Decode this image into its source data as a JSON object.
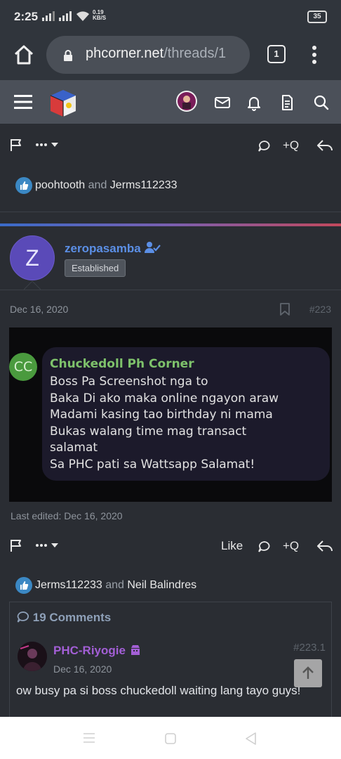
{
  "status": {
    "time": "2:25",
    "net_speed": "0.19",
    "net_unit": "KB/S",
    "battery": "35"
  },
  "browser": {
    "url_host": "phcorner.net",
    "url_rest": "/threads/1",
    "tab_count": "1"
  },
  "post_top": {
    "liked_by_1": "poohtooth",
    "liked_and": "and",
    "liked_by_2": "Jerms112233"
  },
  "post": {
    "avatar_letter": "Z",
    "username": "zeropasamba",
    "badge": "Established",
    "date": "Dec 16, 2020",
    "number": "#223",
    "screenshot": {
      "avatar_initials": "CC",
      "sender": "Chuckedoll Ph Corner",
      "message": "Boss Pa Screenshot nga to\nBaka Di ako maka online ngayon araw\nMadami kasing tao birthday ni mama\nBukas walang time mag transact\nsalamat\nSa PHC pati sa Wattsapp Salamat!"
    },
    "edited": "Last edited: Dec 16, 2020",
    "like_label": "Like",
    "quote_label": "+Q",
    "liked_by_1": "Jerms112233",
    "liked_and": "and",
    "liked_by_2": "Neil Balindres"
  },
  "comments": {
    "header": "19 Comments",
    "first": {
      "username": "PHC-Riyogie",
      "date": "Dec 16, 2020",
      "number": "#223.1",
      "text": "ow busy pa si boss chuckedoll waiting lang tayo guys!"
    }
  },
  "colors": {
    "accent": "#5b8fe6",
    "riyogie": "#a35fd6",
    "like_blue": "#3b88c4"
  }
}
